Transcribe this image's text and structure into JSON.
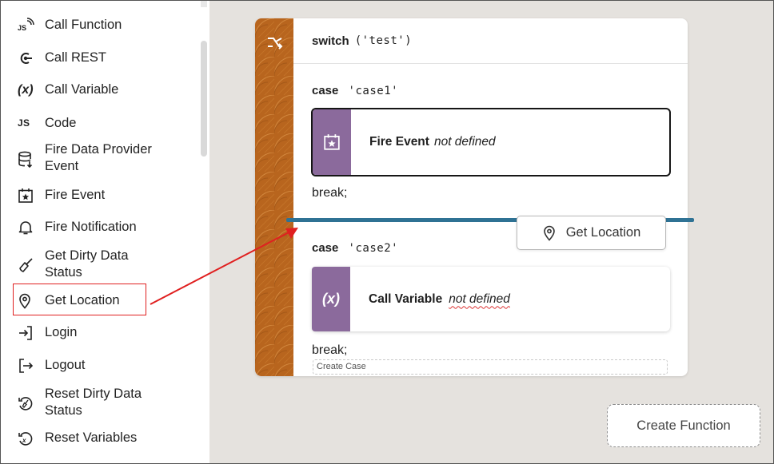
{
  "sidebar": {
    "items": [
      {
        "label": "Call Function",
        "icon": "js-function-icon"
      },
      {
        "label": "Call REST",
        "icon": "rest-icon"
      },
      {
        "label": "Call Variable",
        "icon": "variable-icon",
        "glyph": "(x)"
      },
      {
        "label": "Code",
        "icon": "code-icon",
        "glyph": "JS"
      },
      {
        "label": "Fire Data Provider Event",
        "icon": "database-icon"
      },
      {
        "label": "Fire Event",
        "icon": "calendar-star-icon"
      },
      {
        "label": "Fire Notification",
        "icon": "bell-icon"
      },
      {
        "label": "Get Dirty Data Status",
        "icon": "broom-icon"
      },
      {
        "label": "Get Location",
        "icon": "location-pin-icon"
      },
      {
        "label": "Login",
        "icon": "login-icon"
      },
      {
        "label": "Logout",
        "icon": "logout-icon"
      },
      {
        "label": "Reset Dirty Data Status",
        "icon": "reset-broom-icon"
      },
      {
        "label": "Reset Variables",
        "icon": "reset-variable-icon"
      }
    ]
  },
  "card": {
    "switch_keyword": "switch",
    "switch_arg": "('test')",
    "cases": [
      {
        "keyword": "case",
        "value": "'case1'",
        "action_name": "Fire Event",
        "action_status": "not defined",
        "break": "break;"
      },
      {
        "keyword": "case",
        "value": "'case2'",
        "action_name": "Call Variable",
        "action_status": "not defined",
        "tile_glyph": "(x)",
        "break": "break;"
      }
    ],
    "create_case": "Create Case"
  },
  "drag_ghost": {
    "label": "Get Location"
  },
  "create_function": "Create Function",
  "colors": {
    "rail": "#b8651e",
    "tile": "#8b6a9c",
    "drop_line": "#2f7294",
    "callout": "#e02020",
    "canvas": "#e5e2de"
  }
}
